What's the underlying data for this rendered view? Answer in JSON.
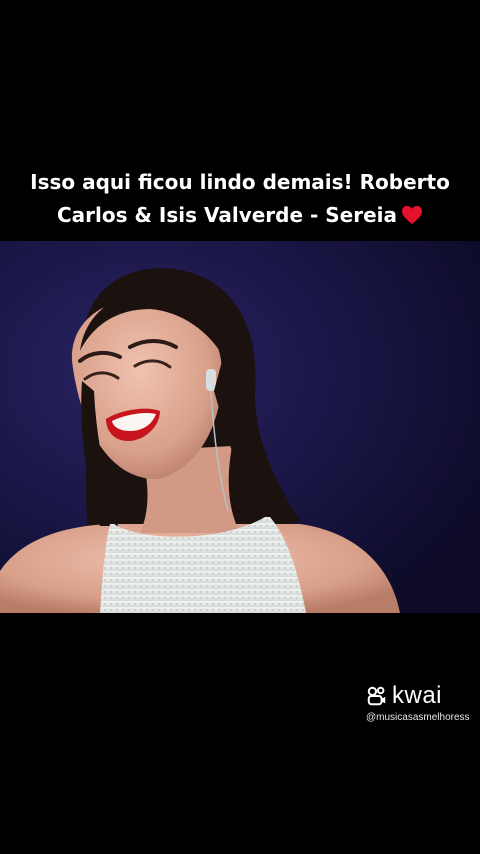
{
  "caption": {
    "line1": "Isso aqui ficou lindo demais! Roberto",
    "line2": "Carlos & Isis Valverde - Sereia",
    "emoji": "red-heart"
  },
  "video": {
    "description_icon": "video-frame"
  },
  "watermark": {
    "brand": "kwai",
    "handle": "@musicasasmelhoress",
    "logo_icon": "kwai-logo-icon"
  },
  "colors": {
    "background": "#000000",
    "text": "#ffffff",
    "heart": "#e8112d",
    "stage": "#1a1646"
  }
}
